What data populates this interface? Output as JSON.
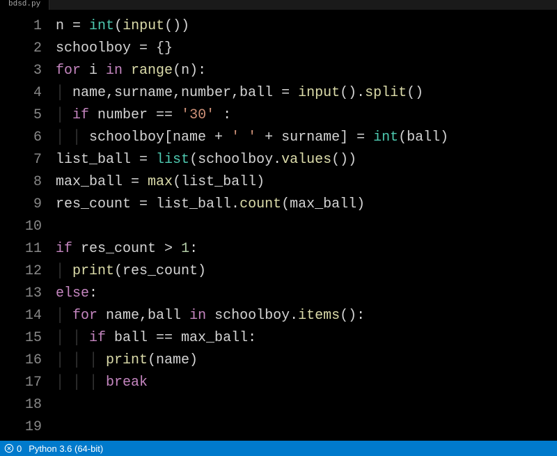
{
  "tab": {
    "label": "bdsd.py"
  },
  "gutter": [
    "1",
    "2",
    "3",
    "4",
    "5",
    "6",
    "7",
    "8",
    "9",
    "10",
    "11",
    "12",
    "13",
    "14",
    "15",
    "16",
    "17",
    "18",
    "19"
  ],
  "code": {
    "l1": {
      "a": "n ",
      "b": "= ",
      "c": "int",
      "d": "(",
      "e": "input",
      "f": "())"
    },
    "l2": {
      "a": "schoolboy ",
      "b": "= {}"
    },
    "l3": {
      "a": "for ",
      "b": "i ",
      "c": "in ",
      "d": "range",
      "e": "(n):"
    },
    "l4": {
      "g": "│ ",
      "a": "name,surname,number,ball ",
      "b": "= ",
      "c": "input",
      "d": "().",
      "e": "split",
      "f": "()"
    },
    "l5": {
      "g": "│ ",
      "a": "if ",
      "b": "number ",
      "c": "== ",
      "d": "'30'",
      "e": " :"
    },
    "l6": {
      "g": "│ │ ",
      "a": "schoolboy[name ",
      "b": "+ ",
      "c": "' '",
      "d": " + ",
      "e": "surname] ",
      "f": "= ",
      "h": "int",
      "i": "(ball)"
    },
    "l7": {
      "a": "list_ball ",
      "b": "= ",
      "c": "list",
      "d": "(schoolboy.",
      "e": "values",
      "f": "())"
    },
    "l8": {
      "a": "max_ball ",
      "b": "= ",
      "c": "max",
      "d": "(list_ball)"
    },
    "l9": {
      "a": "res_count ",
      "b": "= list_ball.",
      "c": "count",
      "d": "(max_ball)"
    },
    "l10": {
      "a": ""
    },
    "l11": {
      "a": "if ",
      "b": "res_count ",
      "c": "> ",
      "d": "1",
      "e": ":"
    },
    "l12": {
      "g": "│ ",
      "a": "print",
      "b": "(res_count)"
    },
    "l13": {
      "a": "else",
      "b": ":"
    },
    "l14": {
      "g": "│ ",
      "a": "for ",
      "b": "name,ball ",
      "c": "in ",
      "d": "schoolboy.",
      "e": "items",
      "f": "():"
    },
    "l15": {
      "g": "│ │ ",
      "a": "if ",
      "b": "ball ",
      "c": "== max_ball:"
    },
    "l16": {
      "g": "│ │ │ ",
      "a": "print",
      "b": "(name)"
    },
    "l17": {
      "g": "│ │ │ ",
      "a": "break"
    },
    "l18": {
      "a": ""
    },
    "l19": {
      "a": ""
    }
  },
  "statusbar": {
    "problems": "0",
    "python": "Python 3.6 (64-bit)"
  }
}
